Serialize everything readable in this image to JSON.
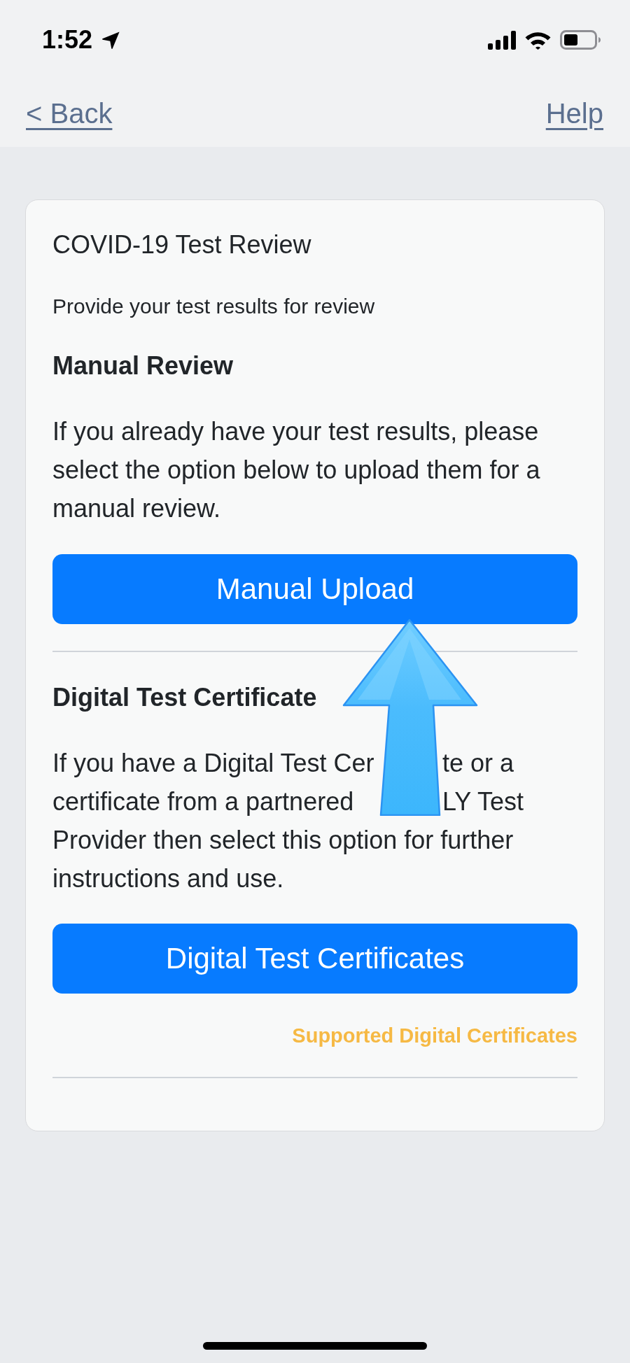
{
  "status_bar": {
    "time": "1:52"
  },
  "nav": {
    "back": "< Back",
    "help": "Help"
  },
  "card": {
    "title": "COVID-19 Test Review",
    "subtitle": "Provide your test results for review",
    "sections": [
      {
        "heading": "Manual Review",
        "body": "If you already have your test results, please select the option below to upload them for a manual review.",
        "button": "Manual Upload"
      },
      {
        "heading": "Digital Test Certificate",
        "covered_lines": [
          {
            "before": "If you have a Digital Test Cer",
            "after": "te or a"
          },
          {
            "before": "certificate from a partnered",
            "after": "LY Test"
          }
        ],
        "body": "Provider then select this option for further instructions and use.",
        "button": "Digital Test Certificates",
        "link": "Supported Digital Certificates"
      }
    ]
  }
}
